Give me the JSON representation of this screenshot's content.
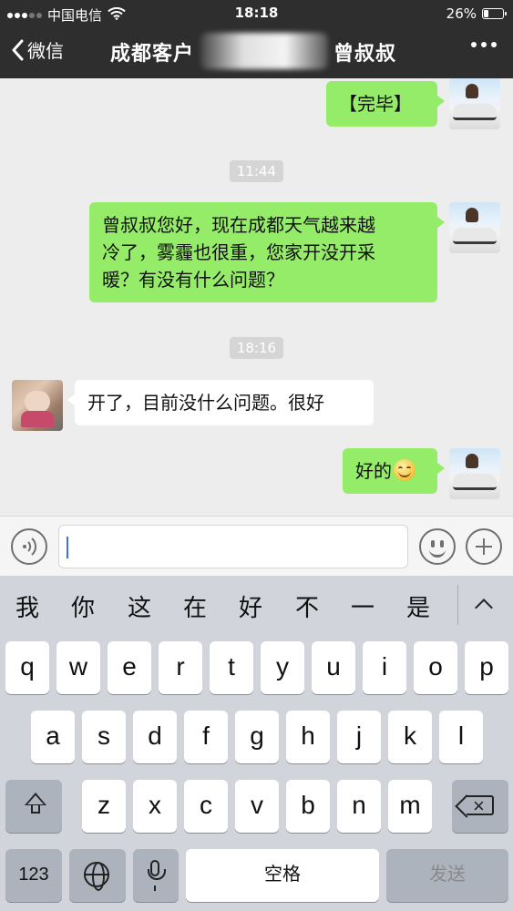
{
  "status_bar": {
    "carrier": "中国电信",
    "time": "18:18",
    "battery": "26%",
    "battery_level": 0.26
  },
  "nav": {
    "back_label": "微信",
    "title": "成都客户",
    "title_suffix": "曾叔叔"
  },
  "messages": [
    {
      "side": "right",
      "text": "【完毕】"
    },
    {
      "side": "time",
      "text": "11:44"
    },
    {
      "side": "right",
      "lines": [
        "曾叔叔您好，现在成都天气越来越",
        "冷了，雾霾也很重，您家开没开采",
        "暖？有没有什么问题？"
      ]
    },
    {
      "side": "time",
      "text": "18:16"
    },
    {
      "side": "left",
      "text": "开了，目前没什么问题。很好"
    },
    {
      "side": "right",
      "text": "好的",
      "emoji": "smiling-face"
    }
  ],
  "input": {
    "value": "",
    "placeholder": ""
  },
  "keyboard": {
    "suggestions": [
      "我",
      "你",
      "这",
      "在",
      "好",
      "不",
      "一",
      "是"
    ],
    "row1": [
      "q",
      "w",
      "e",
      "r",
      "t",
      "y",
      "u",
      "i",
      "o",
      "p"
    ],
    "row2": [
      "a",
      "s",
      "d",
      "f",
      "g",
      "h",
      "j",
      "k",
      "l"
    ],
    "row3": [
      "z",
      "x",
      "c",
      "v",
      "b",
      "n",
      "m"
    ],
    "numbers_label": "123",
    "space_label": "空格",
    "send_label": "发送"
  },
  "colors": {
    "header_bg": "#2e2e2e",
    "chat_bg": "#ededed",
    "my_bubble": "#95ec69",
    "their_bubble": "#ffffff",
    "keyboard_bg": "#d1d4db",
    "caret": "#3e6cf5"
  }
}
